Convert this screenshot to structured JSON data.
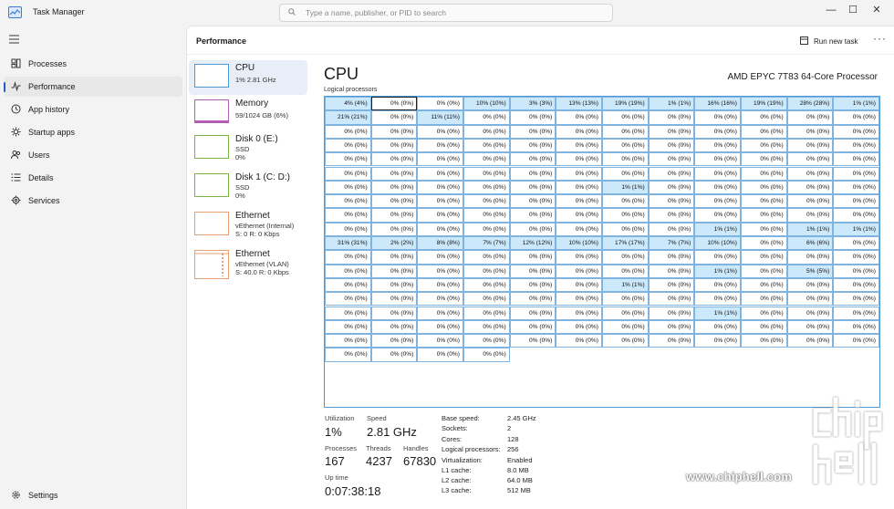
{
  "window": {
    "title": "Task Manager",
    "search_placeholder": "Type a name, publisher, or PID to search",
    "controls": [
      "—",
      "☐",
      "✕"
    ]
  },
  "sidebar": {
    "items": [
      {
        "label": "Processes",
        "icon": "processes-icon",
        "active": false
      },
      {
        "label": "Performance",
        "icon": "performance-icon",
        "active": true
      },
      {
        "label": "App history",
        "icon": "history-icon",
        "active": false
      },
      {
        "label": "Startup apps",
        "icon": "startup-icon",
        "active": false
      },
      {
        "label": "Users",
        "icon": "users-icon",
        "active": false
      },
      {
        "label": "Details",
        "icon": "details-icon",
        "active": false
      },
      {
        "label": "Services",
        "icon": "services-icon",
        "active": false
      }
    ],
    "settings_label": "Settings"
  },
  "header": {
    "title": "Performance",
    "run_task_label": "Run new task",
    "more_label": "···"
  },
  "devices": [
    {
      "name": "CPU",
      "lines": [
        "1% 2.81 GHz"
      ],
      "active": true
    },
    {
      "name": "Memory",
      "lines": [
        "59/1024 GB (6%)"
      ],
      "active": false
    },
    {
      "name": "Disk 0 (E:)",
      "lines": [
        "SSD",
        "0%"
      ],
      "active": false
    },
    {
      "name": "Disk 1 (C: D:)",
      "lines": [
        "SSD",
        "0%"
      ],
      "active": false
    },
    {
      "name": "Ethernet",
      "lines": [
        "vEthernet (Internal)",
        "S: 0 R: 0 Kbps"
      ],
      "active": false
    },
    {
      "name": "Ethernet",
      "lines": [
        "vEthernet (VLAN)",
        "S: 40.0 R: 0 Kbps"
      ],
      "active": false
    }
  ],
  "cpu": {
    "title": "CPU",
    "model": "AMD EPYC 7T83 64-Core Processor",
    "logical_label": "Logical processors",
    "grid_columns": 12,
    "grid_values": [
      4,
      0,
      0,
      10,
      3,
      13,
      19,
      1,
      16,
      19,
      28,
      1,
      21,
      0,
      11,
      0,
      0,
      0,
      0,
      0,
      0,
      0,
      0,
      0,
      0,
      0,
      0,
      0,
      0,
      0,
      0,
      0,
      0,
      0,
      0,
      0,
      0,
      0,
      0,
      0,
      0,
      0,
      0,
      0,
      0,
      0,
      0,
      0,
      0,
      0,
      0,
      0,
      0,
      0,
      0,
      0,
      0,
      0,
      0,
      0,
      0,
      0,
      0,
      0,
      0,
      0,
      0,
      0,
      0,
      0,
      0,
      0,
      0,
      0,
      0,
      0,
      0,
      0,
      1,
      0,
      0,
      0,
      0,
      0,
      0,
      0,
      0,
      0,
      0,
      0,
      0,
      0,
      0,
      0,
      0,
      0,
      0,
      0,
      0,
      0,
      0,
      0,
      0,
      0,
      0,
      0,
      0,
      0,
      0,
      0,
      0,
      0,
      0,
      0,
      0,
      0,
      1,
      0,
      1,
      1,
      31,
      2,
      8,
      7,
      12,
      10,
      17,
      7,
      10,
      0,
      6,
      0,
      0,
      0,
      0,
      0,
      0,
      0,
      0,
      0,
      0,
      0,
      0,
      0,
      0,
      0,
      0,
      0,
      0,
      0,
      0,
      0,
      1,
      0,
      5,
      0,
      0,
      0,
      0,
      0,
      0,
      0,
      1,
      0,
      0,
      0,
      0,
      0,
      0,
      0,
      0,
      0,
      0,
      0,
      0,
      0,
      0,
      0,
      0,
      0,
      0,
      0,
      0,
      0,
      0,
      0,
      0,
      0,
      1,
      0,
      0,
      0,
      0,
      0,
      0,
      0,
      0,
      0,
      0,
      0,
      0,
      0,
      0,
      0,
      0,
      0,
      0,
      0,
      0,
      0,
      0,
      0,
      0,
      0,
      0,
      0,
      0,
      0,
      0,
      0
    ],
    "highlight_color": "#cce8fb",
    "stats": {
      "utilization_label": "Utilization",
      "utilization": "1%",
      "speed_label": "Speed",
      "speed": "2.81 GHz",
      "processes_label": "Processes",
      "processes": "167",
      "threads_label": "Threads",
      "threads": "4237",
      "handles_label": "Handles",
      "handles": "67830",
      "uptime_label": "Up time",
      "uptime": "0:07:38:18"
    },
    "details": [
      {
        "key": "Base speed:",
        "value": "2.45 GHz"
      },
      {
        "key": "Sockets:",
        "value": "2"
      },
      {
        "key": "Cores:",
        "value": "128"
      },
      {
        "key": "Logical processors:",
        "value": "256"
      },
      {
        "key": "Virtualization:",
        "value": "Enabled"
      },
      {
        "key": "L1 cache:",
        "value": "8.0 MB"
      },
      {
        "key": "L2 cache:",
        "value": "64.0 MB"
      },
      {
        "key": "L3 cache:",
        "value": "512 MB"
      }
    ]
  },
  "watermark": {
    "site": "www.chiphell.com",
    "logo_text": "chip hell"
  }
}
